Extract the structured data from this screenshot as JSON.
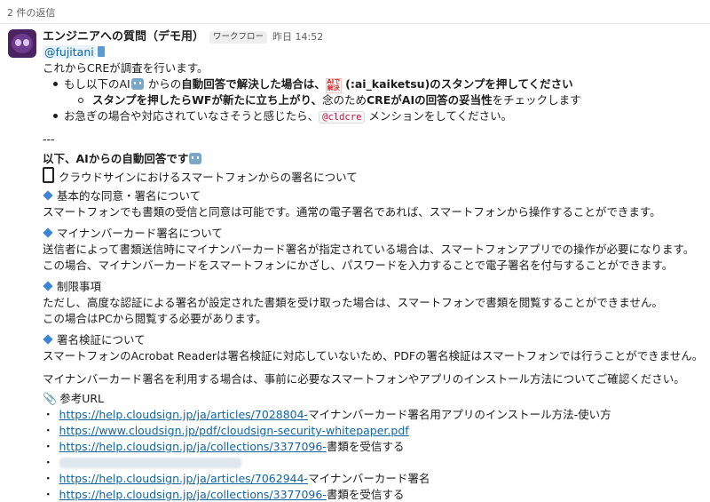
{
  "thread": {
    "reply_count": "2 件の返信"
  },
  "message": {
    "sender": "エンジニアへの質問（デモ用）",
    "badge": "ワークフロー",
    "timestamp": "昨日 14:52",
    "mention": "@fujitani",
    "intro": "これからCREが調査を行います。",
    "bullet1": {
      "a": "もし以下のAI",
      "b": " からの",
      "c": "自動回答で解決した場合は、",
      "stamp": "AIで解決",
      "d": " (:ai_kaiketsu)のスタンプを押してください"
    },
    "sub_bullet": {
      "a": "スタンプを押したらWFが新たに立ち上がり、",
      "b": "念のため",
      "c": "CREがAIの回答の妥当性",
      "d": "をチェックします"
    },
    "bullet2": {
      "a": "お急ぎの場合や対応されていなさそうと感じたら、",
      "code": "@cldcre",
      "b": " メンションをしてください。"
    },
    "divider": "---",
    "ai_header": "以下、AIからの自動回答です",
    "topic": "クラウドサインにおけるスマートフォンからの署名について",
    "sections": [
      {
        "title": "基本的な同意・署名について",
        "lines": [
          "スマートフォンでも書類の受信と同意は可能です。通常の電子署名であれば、スマートフォンから操作することができます。"
        ]
      },
      {
        "title": "マイナンバーカード署名について",
        "lines": [
          "送信者によって書類送信時にマイナンバーカード署名が指定されている場合は、スマートフォンアプリでの操作が必要になります。",
          "この場合、マイナンバーカードをスマートフォンにかざし、パスワードを入力することで電子署名を付与することができます。"
        ]
      },
      {
        "title": "制限事項",
        "lines": [
          "ただし、高度な認証による署名が設定された書類を受け取った場合は、スマートフォンで書類を閲覧することができません。",
          "この場合はPCから閲覧する必要があります。"
        ]
      },
      {
        "title": "署名検証について",
        "lines": [
          "スマートフォンのAcrobat Readerは署名検証に対応していないため、PDFの署名検証はスマートフォンでは行うことができません。"
        ]
      }
    ],
    "closing": "マイナンバーカード署名を利用する場合は、事前に必要なスマートフォンやアプリのインストール方法についてご確認ください。",
    "ref_header": "参考URL",
    "refs": [
      {
        "url": "https://help.cloudsign.jp/ja/articles/7028804-",
        "text": "マイナンバーカード署名用アプリのインストール方法-使い方"
      },
      {
        "url": "https://www.cloudsign.jp/pdf/cloudsign-security-whitepaper.pdf",
        "text": ""
      },
      {
        "url": "https://help.cloudsign.jp/ja/collections/3377096-",
        "text": "書類を受信する"
      },
      {
        "url": "",
        "text": ""
      },
      {
        "url": "https://help.cloudsign.jp/ja/articles/7062944-",
        "text": "マイナンバーカード署名"
      },
      {
        "url": "https://help.cloudsign.jp/ja/collections/3377096-",
        "text": "書類を受信する"
      }
    ],
    "bullet_char": "・"
  }
}
